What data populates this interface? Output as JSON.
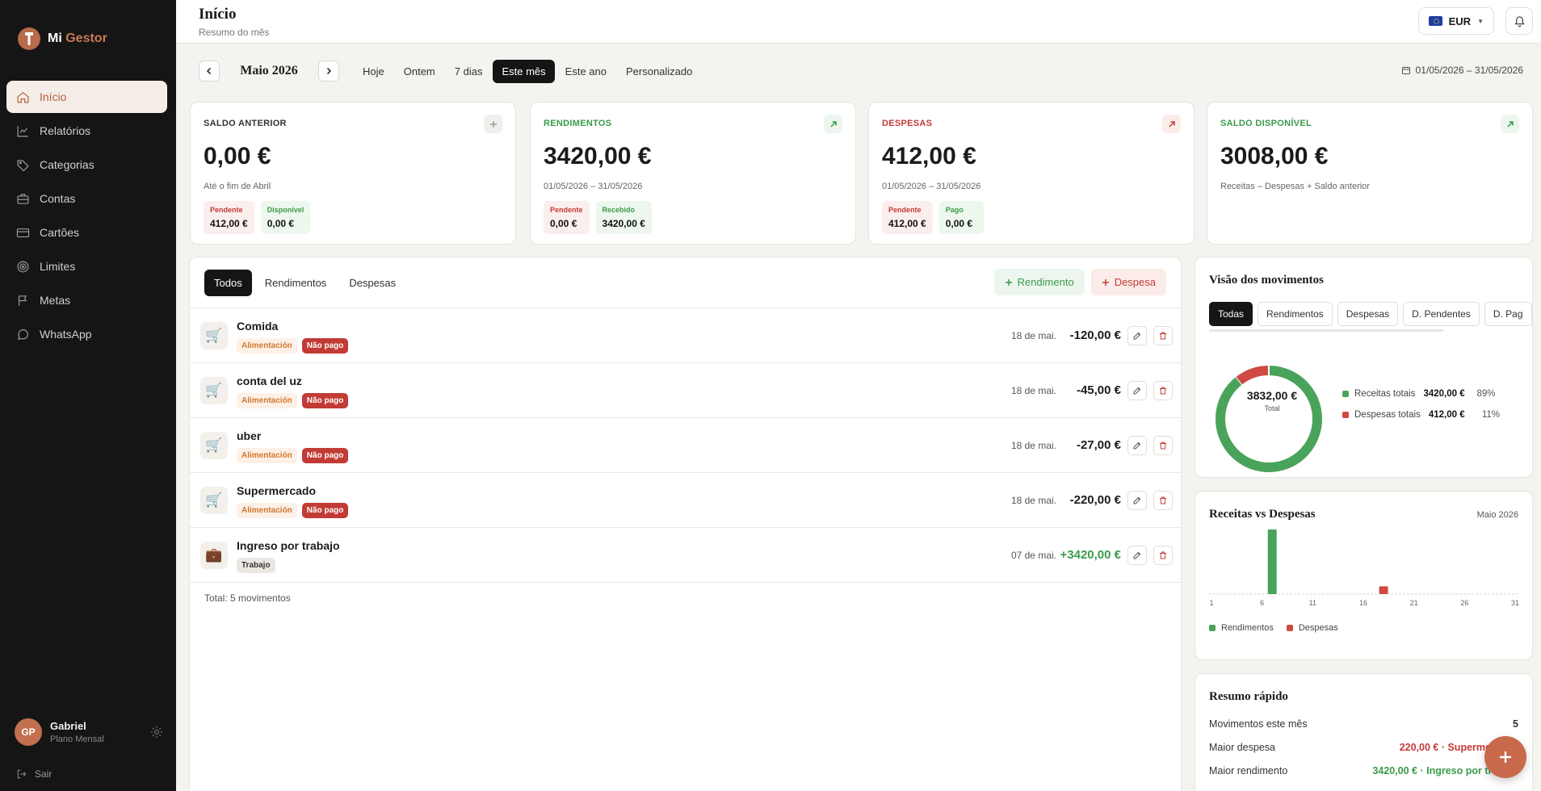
{
  "app": {
    "name_a": "Mi",
    "name_b": "Gestor"
  },
  "sidebar": {
    "items": [
      {
        "label": "Início",
        "icon": "home-icon"
      },
      {
        "label": "Relatórios",
        "icon": "chart-line-icon"
      },
      {
        "label": "Categorias",
        "icon": "tag-icon"
      },
      {
        "label": "Contas",
        "icon": "briefcase-icon"
      },
      {
        "label": "Cartões",
        "icon": "credit-card-icon"
      },
      {
        "label": "Limites",
        "icon": "target-icon"
      },
      {
        "label": "Metas",
        "icon": "flag-icon"
      },
      {
        "label": "WhatsApp",
        "icon": "chat-bubble-icon"
      }
    ],
    "user": {
      "initials": "GP",
      "name": "Gabriel",
      "plan": "Plano Mensal"
    },
    "logout": "Sair"
  },
  "header": {
    "title": "Início",
    "subtitle": "Resumo do mês",
    "currency": "EUR"
  },
  "datebar": {
    "month": "Maio 2026",
    "ranges": [
      "Hoje",
      "Ontem",
      "7 dias",
      "Este mês",
      "Este ano",
      "Personalizado"
    ],
    "active_range": "Este mês",
    "date_range": "01/05/2026 – 31/05/2026"
  },
  "cards": [
    {
      "label": "SALDO ANTERIOR",
      "value": "0,00 €",
      "sub": "Até o fim de Abril",
      "chips": [
        {
          "label": "Pendente",
          "value": "412,00 €"
        },
        {
          "label": "Disponível",
          "value": "0,00 €"
        }
      ]
    },
    {
      "label": "RENDIMENTOS",
      "value": "3420,00 €",
      "sub": "01/05/2026 – 31/05/2026",
      "chips": [
        {
          "label": "Pendente",
          "value": "0,00 €"
        },
        {
          "label": "Recebido",
          "value": "3420,00 €"
        }
      ]
    },
    {
      "label": "DESPESAS",
      "value": "412,00 €",
      "sub": "01/05/2026 – 31/05/2026",
      "chips": [
        {
          "label": "Pendente",
          "value": "412,00 €"
        },
        {
          "label": "Pago",
          "value": "0,00 €"
        }
      ]
    },
    {
      "label": "SALDO DISPONÍVEL",
      "value": "3008,00 €",
      "sub": "Receitas – Despesas + Saldo anterior"
    }
  ],
  "transactions": {
    "tabs": [
      "Todos",
      "Rendimentos",
      "Despesas"
    ],
    "add_income": "Rendimento",
    "add_expense": "Despesa",
    "rows": [
      {
        "name": "Comida",
        "category": "Alimentación",
        "status": "Não pago",
        "date": "18 de mai.",
        "amount": "-120,00 €",
        "icon": "🛒"
      },
      {
        "name": "conta del uz",
        "category": "Alimentación",
        "status": "Não pago",
        "date": "18 de mai.",
        "amount": "-45,00 €",
        "icon": "🛒"
      },
      {
        "name": "uber",
        "category": "Alimentación",
        "status": "Não pago",
        "date": "18 de mai.",
        "amount": "-27,00 €",
        "icon": "🛒"
      },
      {
        "name": "Supermercado",
        "category": "Alimentación",
        "status": "Não pago",
        "date": "18 de mai.",
        "amount": "-220,00 €",
        "icon": "🛒"
      },
      {
        "name": "Ingreso por trabajo",
        "category": "Trabajo",
        "status": "",
        "date": "07 de mai.",
        "amount": "+3420,00 €",
        "icon": "💼"
      }
    ],
    "total": "Total: 5 movimentos"
  },
  "overview": {
    "title": "Visão dos movimentos",
    "filters": [
      "Todas",
      "Rendimentos",
      "Despesas",
      "D. Pendentes",
      "D. Pag"
    ],
    "total_value": "3832,00 €",
    "total_label": "Total",
    "legend": [
      {
        "label": "Receitas totais",
        "value": "3420,00 €",
        "pct": "89%"
      },
      {
        "label": "Despesas totais",
        "value": "412,00 €",
        "pct": "11%"
      }
    ]
  },
  "bars": {
    "title": "Receitas vs Despesas",
    "period": "Maio 2026",
    "legend_income": "Rendimentos",
    "legend_expense": "Despesas"
  },
  "summary": {
    "title": "Resumo rápido",
    "rows": [
      {
        "label": "Movimentos este mês",
        "value": "5"
      },
      {
        "label": "Maior despesa",
        "value": "220,00 € · Supermercado"
      },
      {
        "label": "Maior rendimento",
        "value": "3420,00 € · Ingreso por trabajo"
      }
    ]
  },
  "colors": {
    "accent": "#c9694c",
    "income": "#3a9a4b",
    "expense": "#c23b35",
    "sidebar": "#151515"
  },
  "chart_data": [
    {
      "type": "pie",
      "title": "Visão dos movimentos",
      "categories": [
        "Receitas totais",
        "Despesas totais"
      ],
      "values": [
        3420,
        412
      ],
      "colors": [
        "#4aa35a",
        "#cf4a43"
      ]
    },
    {
      "type": "bar",
      "title": "Receitas vs Despesas",
      "x": [
        1,
        6,
        7,
        11,
        16,
        18,
        21,
        26,
        31
      ],
      "xticks": [
        "1",
        "6",
        "11",
        "16",
        "21",
        "26",
        "31"
      ],
      "xlim": [
        1,
        31
      ],
      "series": [
        {
          "name": "Rendimentos",
          "points": [
            [
              7,
              3420
            ]
          ],
          "color": "#4aa35a"
        },
        {
          "name": "Despesas",
          "points": [
            [
              18,
              412
            ]
          ],
          "color": "#cf4a43"
        }
      ],
      "ylim": [
        0,
        3420
      ]
    }
  ]
}
